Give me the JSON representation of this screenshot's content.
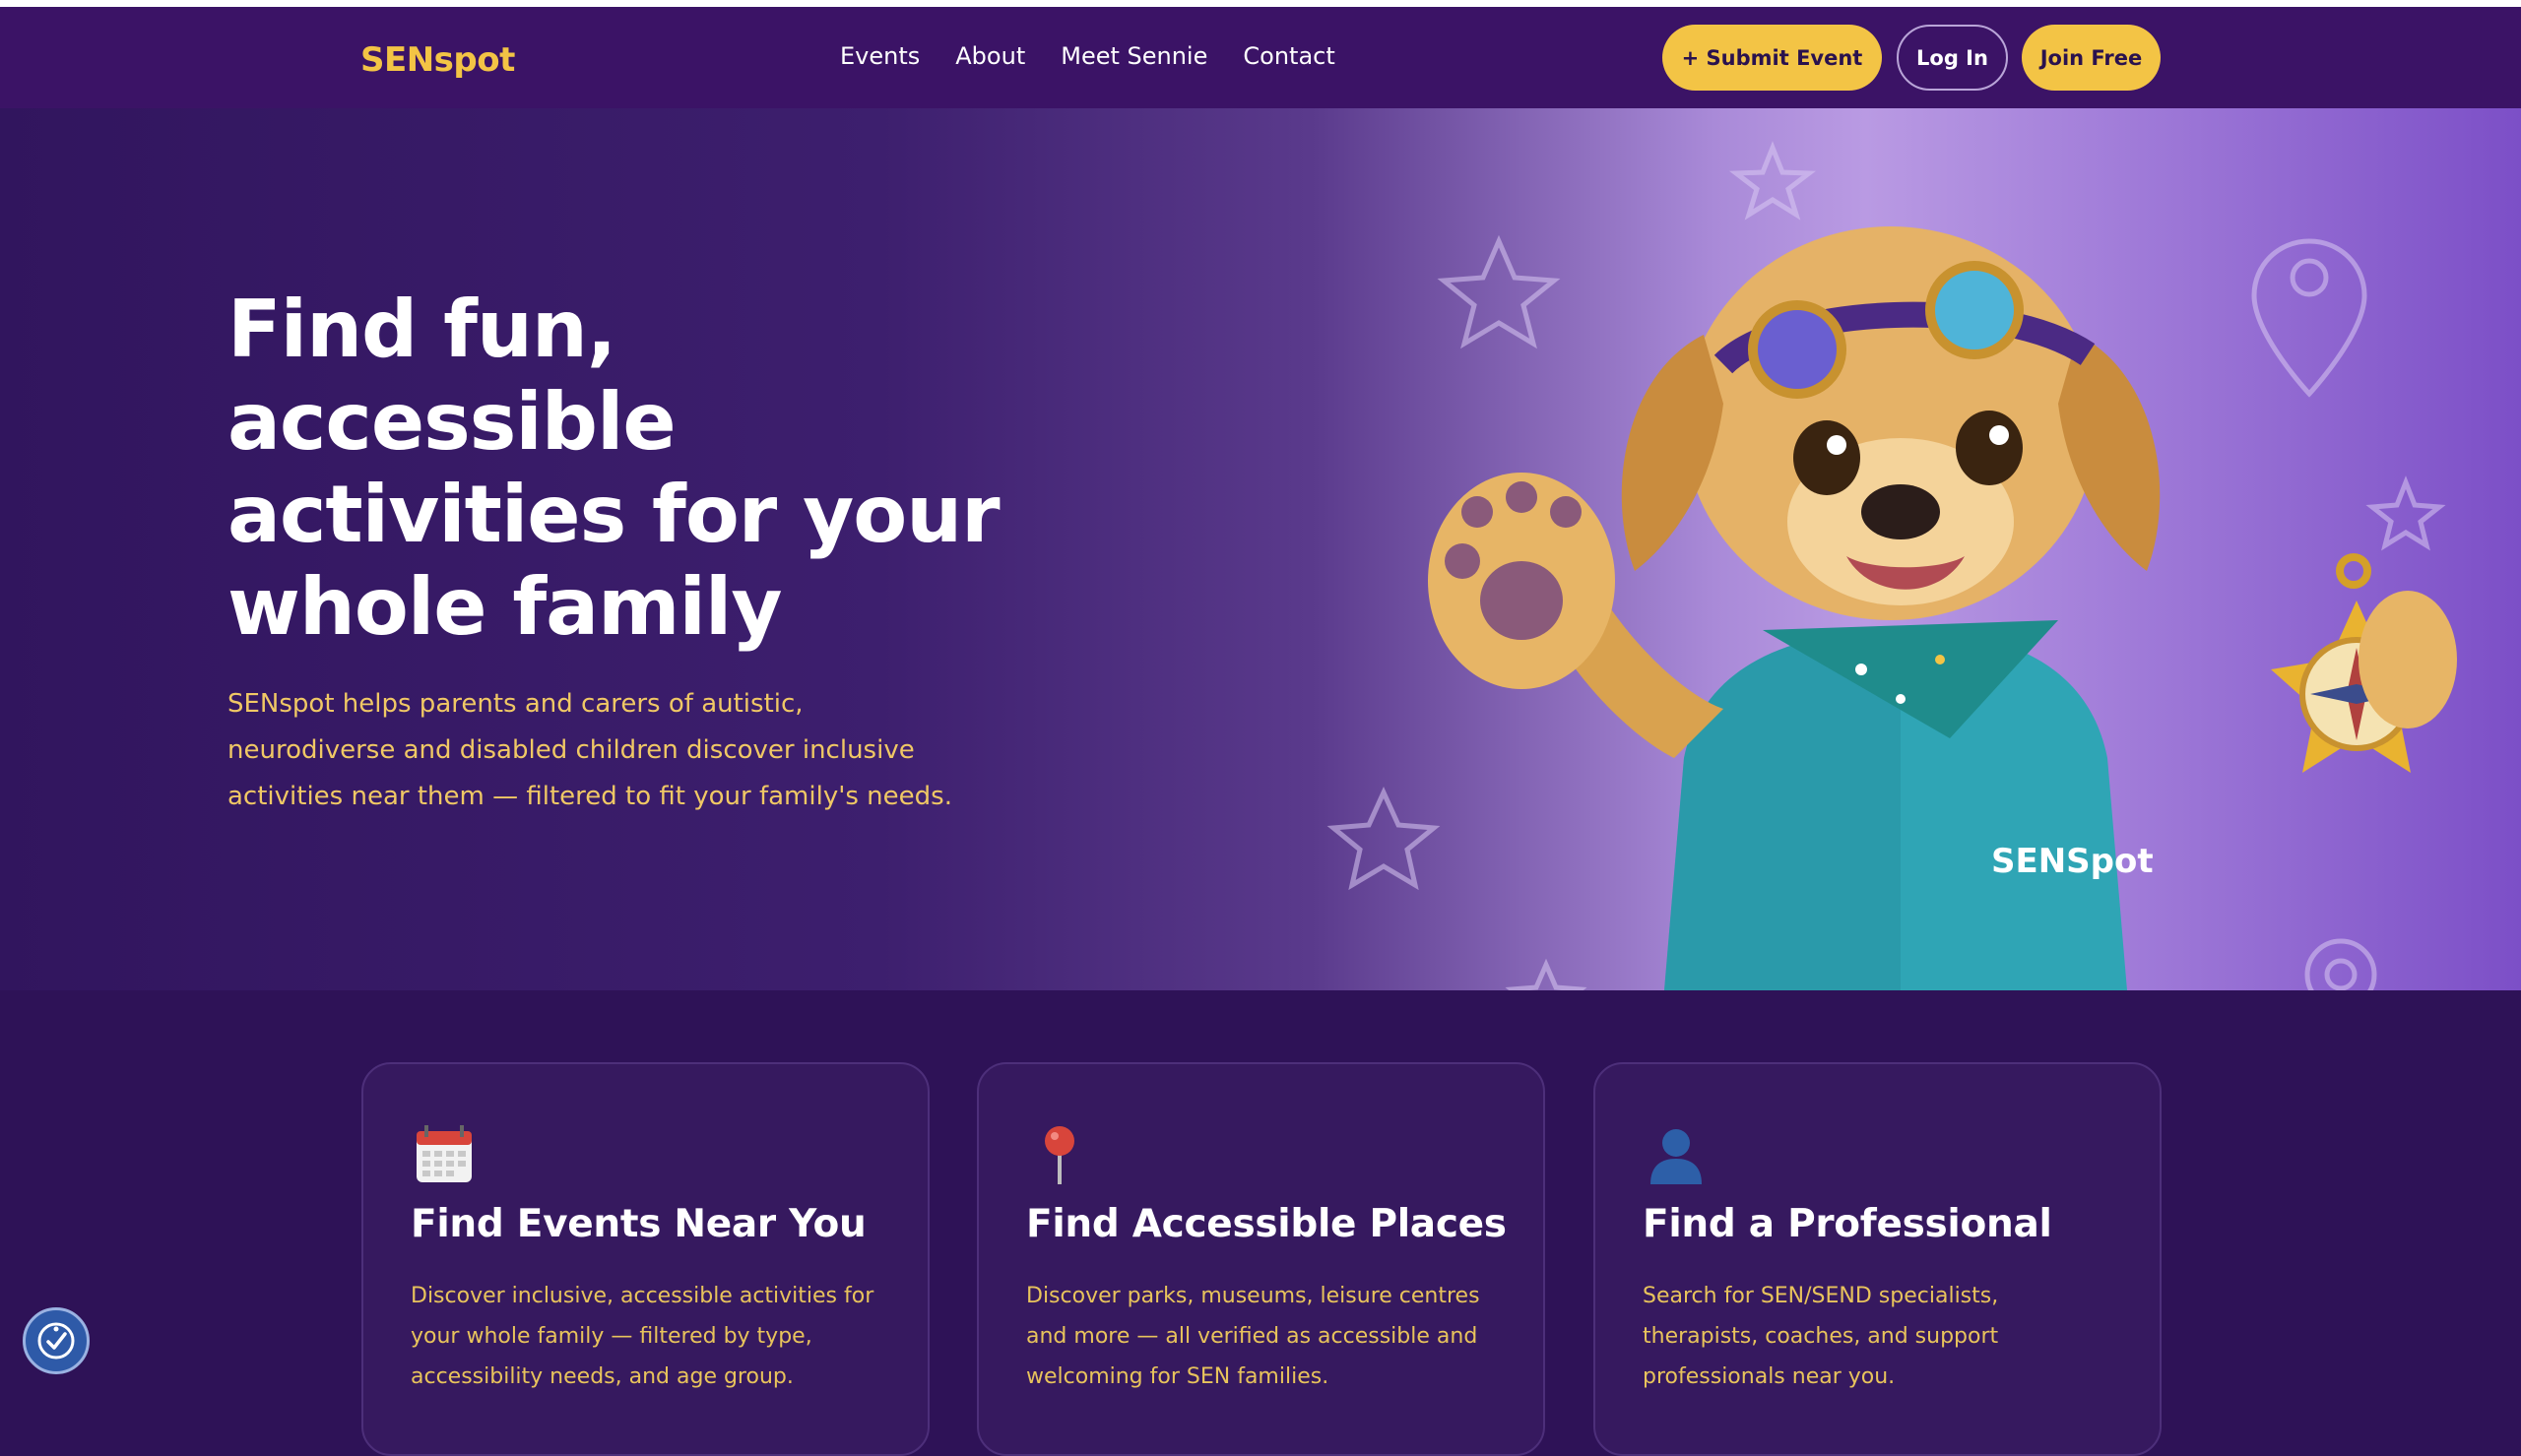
{
  "brand": {
    "logo": "SENspot",
    "accent": "#f3c445",
    "nav_bg": "#3b1366",
    "page_bg": "#2e1257"
  },
  "nav": {
    "links": [
      "Events",
      "About",
      "Meet Sennie",
      "Contact"
    ],
    "submit_label": "+ Submit Event",
    "login_label": "Log In",
    "join_label": "Join Free"
  },
  "hero": {
    "title": "Find fun, accessible activities for your whole family",
    "subtitle": "SENspot helps parents and carers of autistic, neurodiverse and disabled children discover inclusive activities near them — filtered to fit your family's needs.",
    "mascot_shirt_text": "SENSpot",
    "mascot_icon": "puppy-mascot-with-compass"
  },
  "cards": [
    {
      "icon": "calendar-icon",
      "title": "Find Events Near You",
      "desc": "Discover inclusive, accessible activities for your whole family — filtered by type, accessibility needs, and age group."
    },
    {
      "icon": "map-pin-icon",
      "title": "Find Accessible Places",
      "desc": "Discover parks, museums, leisure centres and more — all verified as accessible and welcoming for SEN families."
    },
    {
      "icon": "person-icon",
      "title": "Find a Professional",
      "desc": "Search for SEN/SEND specialists, therapists, coaches, and support professionals near you."
    }
  ],
  "accessibility_widget": {
    "icon": "accessibility-icon"
  }
}
